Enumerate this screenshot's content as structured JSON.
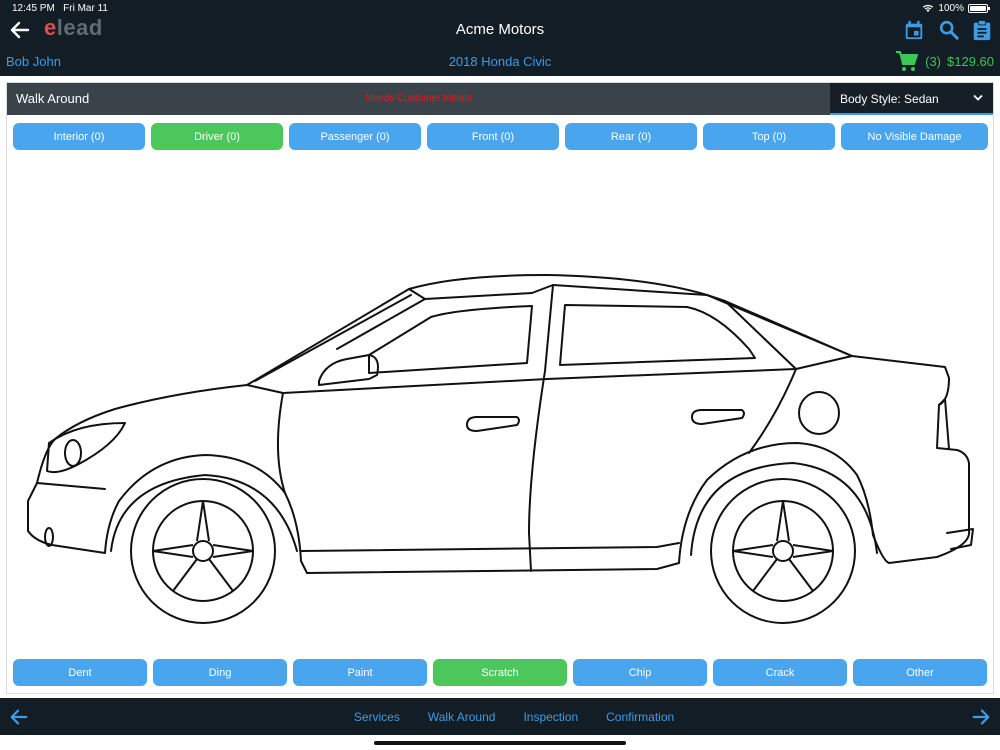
{
  "status_bar": {
    "time": "12:45 PM",
    "date": "Fri Mar 11",
    "battery": "100%",
    "battery_level": 1.0
  },
  "header": {
    "logo_accent": "e",
    "logo_rest": "lead",
    "title": "Acme Motors",
    "customer": "Bob John",
    "vehicle": "2018 Honda Civic",
    "cart_count": "(3)",
    "cart_total": "$129.60",
    "icons": [
      "back-arrow-icon",
      "calendar-icon",
      "search-icon",
      "clipboard-icon",
      "cart-icon"
    ]
  },
  "section": {
    "title": "Walk Around",
    "warning": "Needs Customer Initials",
    "body_style": "Body Style: Sedan"
  },
  "view_tabs": [
    {
      "label": "Interior (0)"
    },
    {
      "label": "Driver (0)"
    },
    {
      "label": "Passenger (0)"
    },
    {
      "label": "Front (0)"
    },
    {
      "label": "Rear (0)"
    },
    {
      "label": "Top (0)"
    },
    {
      "label": "No Visible Damage"
    }
  ],
  "active_view": "Driver (0)",
  "damage_types": [
    {
      "label": "Dent"
    },
    {
      "label": "Ding"
    },
    {
      "label": "Paint"
    },
    {
      "label": "Scratch"
    },
    {
      "label": "Chip"
    },
    {
      "label": "Crack"
    },
    {
      "label": "Other"
    }
  ],
  "active_damage": "Scratch",
  "bottom_nav": [
    {
      "label": "Services"
    },
    {
      "label": "Walk Around"
    },
    {
      "label": "Inspection"
    },
    {
      "label": "Confirmation"
    }
  ],
  "colors": {
    "header_bg": "#131d26",
    "link_blue": "#3d9ce6",
    "button_blue": "#48a5ee",
    "active_green": "#4cc75c",
    "cart_green": "#3cc653",
    "warning_red": "#d42020"
  }
}
